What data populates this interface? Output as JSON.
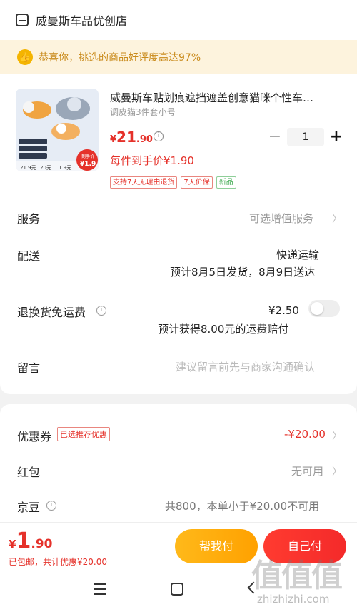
{
  "store": {
    "name": "威曼斯车品优创店"
  },
  "banner": {
    "text": "恭喜你，挑选的商品好评度高达97%"
  },
  "product": {
    "title": "威曼斯车贴划痕遮挡遮盖创意猫咪个性车…",
    "spec": "调皮猫3件套小号",
    "price_yen": "¥",
    "price_int": "21",
    "price_dec": ".90",
    "quantity": "1",
    "hand_price": "每件到手价¥1.90",
    "tags": [
      "支持7天无理由退货",
      "7天价保",
      "新品"
    ]
  },
  "rows": {
    "service_label": "服务",
    "service_value": "可选增值服务",
    "delivery_label": "配送",
    "delivery_method": "快递运输",
    "delivery_eta": "预计8月5日发货，8月9日送达",
    "return_label": "退换货免运费",
    "return_price": "¥2.50",
    "return_note": "预计获得8.00元的运费赔付",
    "note_label": "留言",
    "note_placeholder": "建议留言前先与商家沟通确认"
  },
  "discounts": {
    "coupon_label": "优惠券",
    "coupon_tag": "已选推荐优惠",
    "coupon_value": "-¥20.00",
    "redpack_label": "红包",
    "redpack_value": "无可用",
    "jingdou_label": "京豆",
    "jingdou_value": "共800，本单小于¥20.00不可用"
  },
  "footer": {
    "total_yen": "¥",
    "total_int": "1",
    "total_dec": ".90",
    "total_note": "已包邮，共计优惠¥20.00",
    "help_pay": "帮我付",
    "self_pay": "自己付"
  },
  "watermark": {
    "big": "值值值",
    "small": "zhizhizhi.com"
  },
  "colors": {
    "accent_red": "#e5312a",
    "banner_bg": "#fdf3dd",
    "help_btn": "#ffb91a",
    "self_btn": "#ff3b30"
  }
}
